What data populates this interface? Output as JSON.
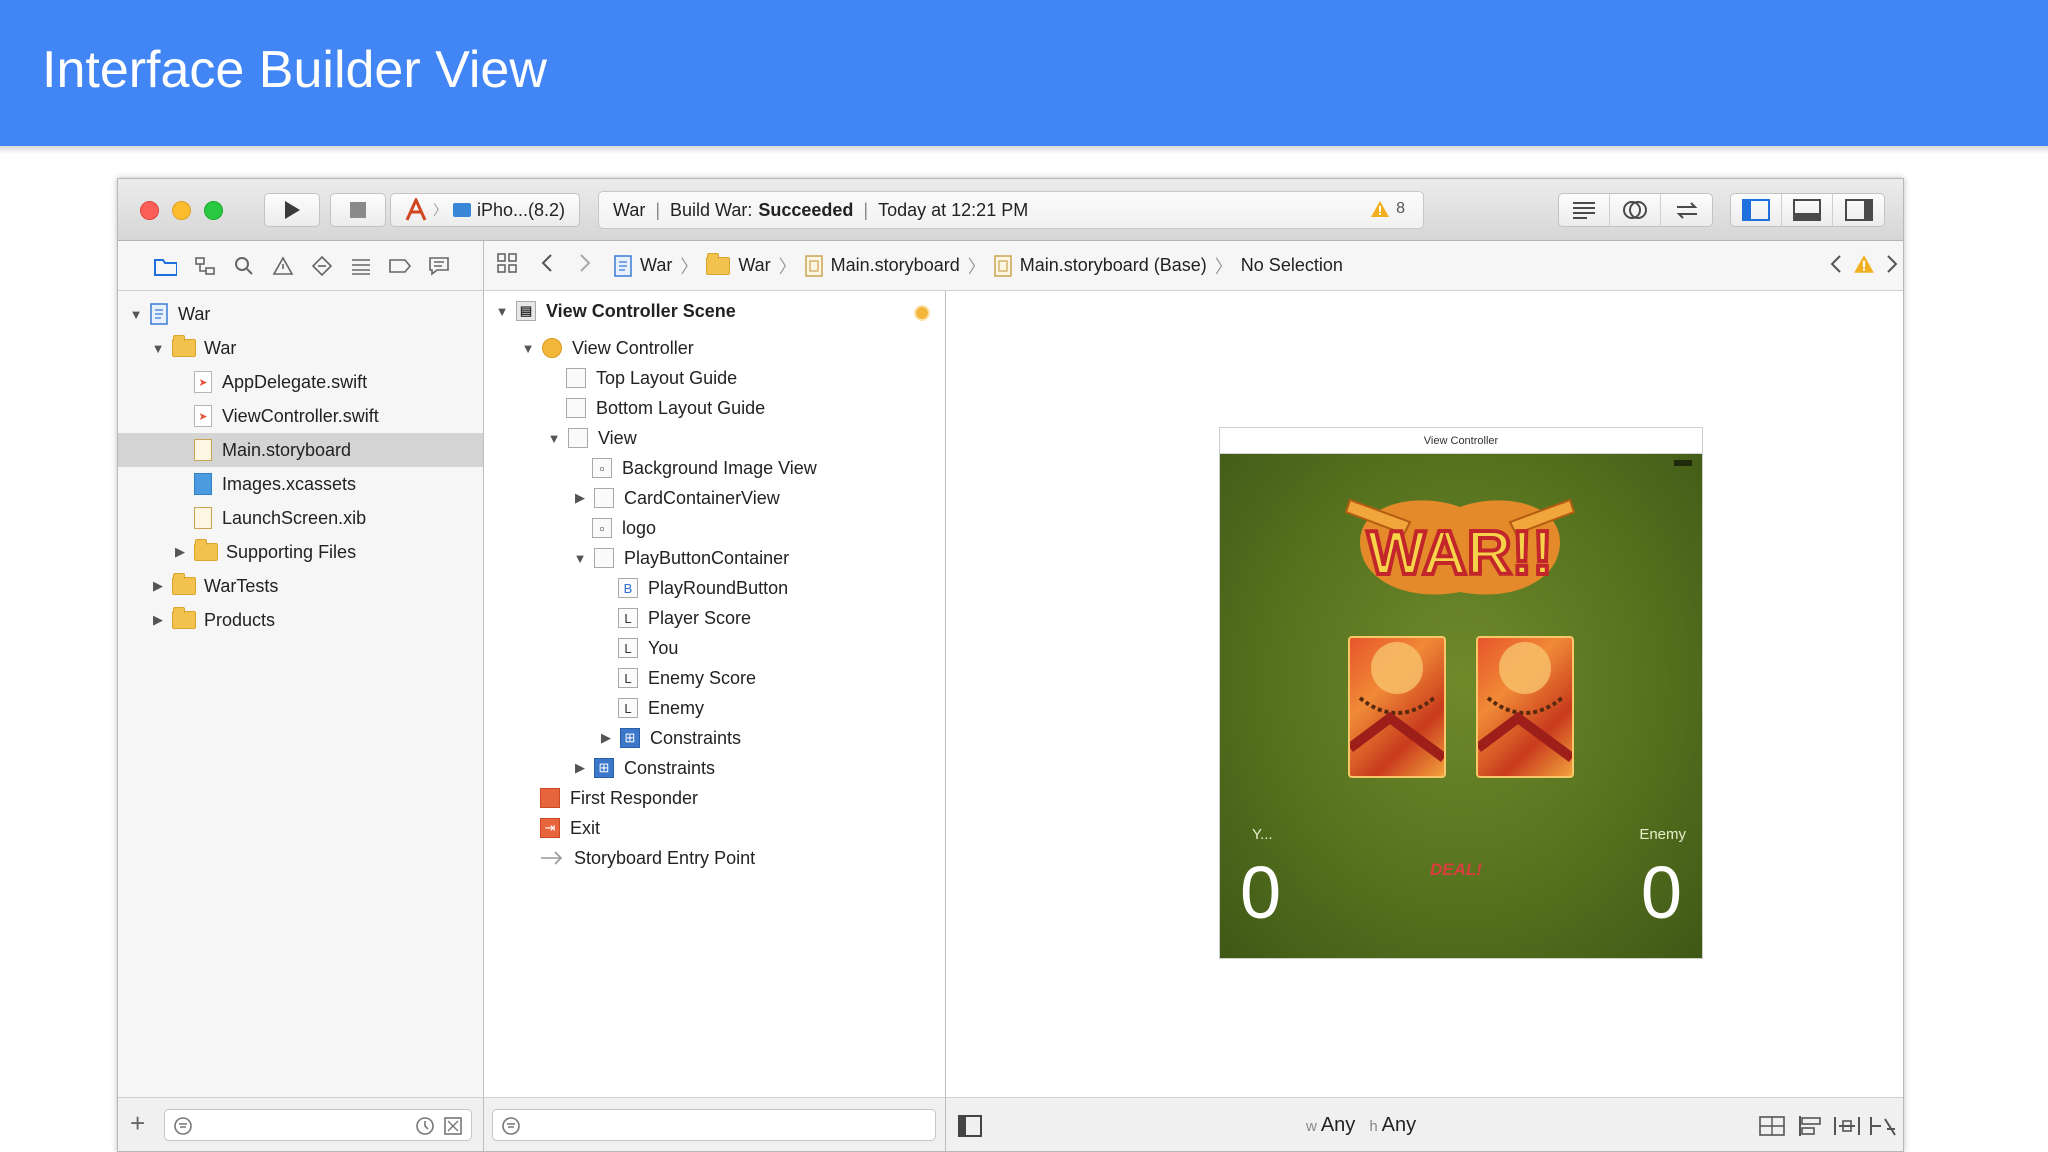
{
  "slide": {
    "title": "Interface Builder View"
  },
  "toolbar": {
    "scheme_device": "iPho...(8.2)",
    "status_project": "War",
    "status_build_prefix": "Build War:",
    "status_build_result": "Succeeded",
    "status_time": "Today at 12:21 PM",
    "warning_count": "8"
  },
  "jump_bar": {
    "crumbs": [
      "War",
      "War",
      "Main.storyboard",
      "Main.storyboard (Base)",
      "No Selection"
    ]
  },
  "navigator": {
    "items": [
      {
        "label": "War"
      },
      {
        "label": "War"
      },
      {
        "label": "AppDelegate.swift"
      },
      {
        "label": "ViewController.swift"
      },
      {
        "label": "Main.storyboard"
      },
      {
        "label": "Images.xcassets"
      },
      {
        "label": "LaunchScreen.xib"
      },
      {
        "label": "Supporting Files"
      },
      {
        "label": "WarTests"
      },
      {
        "label": "Products"
      }
    ]
  },
  "outline": {
    "scene": "View Controller Scene",
    "items": [
      {
        "label": "View Controller",
        "icon": "vc-icon"
      },
      {
        "label": "Top Layout Guide",
        "icon": "layout-guide-icon"
      },
      {
        "label": "Bottom Layout Guide",
        "icon": "layout-guide-icon"
      },
      {
        "label": "View",
        "icon": "view-icon"
      },
      {
        "label": "Background Image View",
        "icon": "image-view-icon"
      },
      {
        "label": "CardContainerView",
        "icon": "view-icon"
      },
      {
        "label": "logo",
        "icon": "image-view-icon"
      },
      {
        "label": "PlayButtonContainer",
        "icon": "view-icon"
      },
      {
        "label": "PlayRoundButton",
        "icon": "button-icon",
        "glyph": "B"
      },
      {
        "label": "Player Score",
        "icon": "label-icon",
        "glyph": "L"
      },
      {
        "label": "You",
        "icon": "label-icon",
        "glyph": "L"
      },
      {
        "label": "Enemy Score",
        "icon": "label-icon",
        "glyph": "L"
      },
      {
        "label": "Enemy",
        "icon": "label-icon",
        "glyph": "L"
      },
      {
        "label": "Constraints",
        "icon": "constraints-icon"
      },
      {
        "label": "Constraints",
        "icon": "constraints-icon"
      },
      {
        "label": "First Responder",
        "icon": "first-responder-icon"
      },
      {
        "label": "Exit",
        "icon": "exit-icon"
      },
      {
        "label": "Storyboard Entry Point",
        "icon": "entry-point-icon"
      }
    ]
  },
  "canvas": {
    "vc_title": "View Controller",
    "logo_text": "WAR!!",
    "player_label": "Y...",
    "enemy_label": "Enemy",
    "player_score": "0",
    "enemy_score": "0",
    "deal_button": "DEAL!",
    "size_class_w_prefix": "w",
    "size_class_w": "Any",
    "size_class_h_prefix": "h",
    "size_class_h": "Any"
  },
  "colors": {
    "header": "#4285f4",
    "selection": "#d4d4d4",
    "game_green": "#56721e"
  }
}
